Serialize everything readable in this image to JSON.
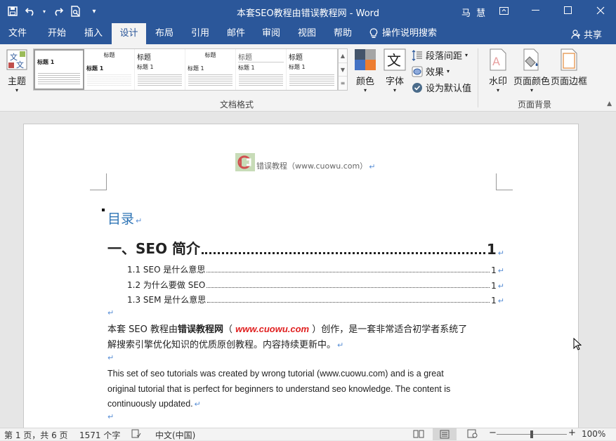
{
  "titlebar": {
    "title": "本套SEO教程由错误教程网  -  Word",
    "user": "马 慧"
  },
  "tabs": [
    "文件",
    "开始",
    "插入",
    "设计",
    "布局",
    "引用",
    "邮件",
    "审阅",
    "视图",
    "帮助"
  ],
  "tell_me": "操作说明搜索",
  "share_label": "共享",
  "ribbon": {
    "theme_label": "主题",
    "styles": [
      {
        "title": "",
        "h": "标题 1"
      },
      {
        "title": "标题",
        "h": "标题 1"
      },
      {
        "title": "标题",
        "h": "标题 1"
      },
      {
        "title": "标题",
        "h": "标题 1"
      },
      {
        "title": "标题",
        "h": "标题 1"
      },
      {
        "title": "标题",
        "h": "标题 1"
      }
    ],
    "colors_label": "颜色",
    "fonts_label": "字体",
    "paragraph_spacing_label": "段落间距",
    "effects_label": "效果",
    "set_default_label": "设为默认值",
    "group_doc_format": "文档格式",
    "watermark_label": "水印",
    "page_color_label": "页面颜色",
    "page_border_label": "页面边框",
    "group_page_bg": "页面背景"
  },
  "document": {
    "header_text": "错误教程（www.cuowu.com）",
    "toc_heading": "目录",
    "toc_h1": {
      "text": "一、SEO 简介",
      "page": "1"
    },
    "toc_items": [
      {
        "text": "1.1 SEO 是什么意思",
        "page": "1"
      },
      {
        "text": "1.2  为什么要做 SEO",
        "page": "1"
      },
      {
        "text": "1.3 SEM 是什么意思",
        "page": "1"
      }
    ],
    "cn_para": {
      "pre": "本套 SEO 教程由",
      "bold": "错误教程网",
      "open": "（",
      "link": "www.cuowu.com",
      "close": "）创作，是一套非常适合初学者系统了",
      "line2": "解搜索引擎优化知识的优质原创教程。内容持续更新中。"
    },
    "en_para": {
      "line1": "This set of seo tutorials was created by wrong tutorial (www.cuowu.com) and is a great",
      "line2": "original tutorial that is perfect for beginners to understand seo knowledge. The content is",
      "line3": "continuously updated."
    }
  },
  "status": {
    "page": "第 1 页，共 6 页",
    "words": "1571 个字",
    "language": "中文(中国)",
    "zoom": "100%",
    "zoom_level": 1.0
  },
  "colors": {
    "brand": "#2b579a",
    "heading_blue": "#2e74b5",
    "link_red": "#e02020"
  }
}
